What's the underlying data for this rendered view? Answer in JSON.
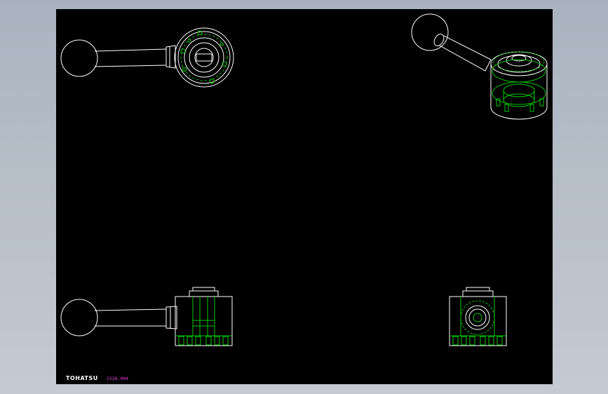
{
  "drawing": {
    "brand_label": "TOHATSU",
    "part_number": "2326.004"
  },
  "colors": {
    "background": "#b6bec8",
    "sheet": "#000000",
    "outline": "#ffffff",
    "hidden_lines": "#00c800",
    "annotation": "#e040e0"
  },
  "views": [
    {
      "name": "top-view"
    },
    {
      "name": "isometric-view"
    },
    {
      "name": "front-view"
    },
    {
      "name": "side-view"
    }
  ]
}
